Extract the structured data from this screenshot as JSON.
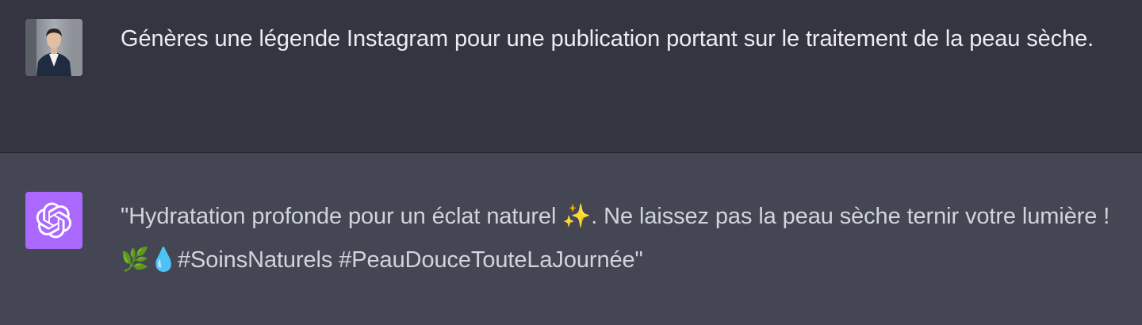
{
  "conversation": {
    "user_message": {
      "avatar": "user-profile-photo",
      "text": "Génères une légende Instagram pour une publication portant sur le traitement de la peau sèche."
    },
    "assistant_message": {
      "avatar": "openai-logo-icon",
      "avatar_color": "#ab68ff",
      "text_part1": "\"Hydratation profonde pour un éclat naturel ",
      "emoji_sparkles": "✨",
      "text_part2": ". Ne laissez pas la peau sèche ternir votre lumière ! ",
      "emoji_herb": "🌿",
      "emoji_droplet": "💧",
      "text_part3": "#SoinsNaturels #PeauDouceTouteLaJournée\""
    }
  },
  "colors": {
    "user_bg": "#343541",
    "assistant_bg": "#444654",
    "user_text": "#ececf1",
    "assistant_text": "#d1d5db"
  }
}
